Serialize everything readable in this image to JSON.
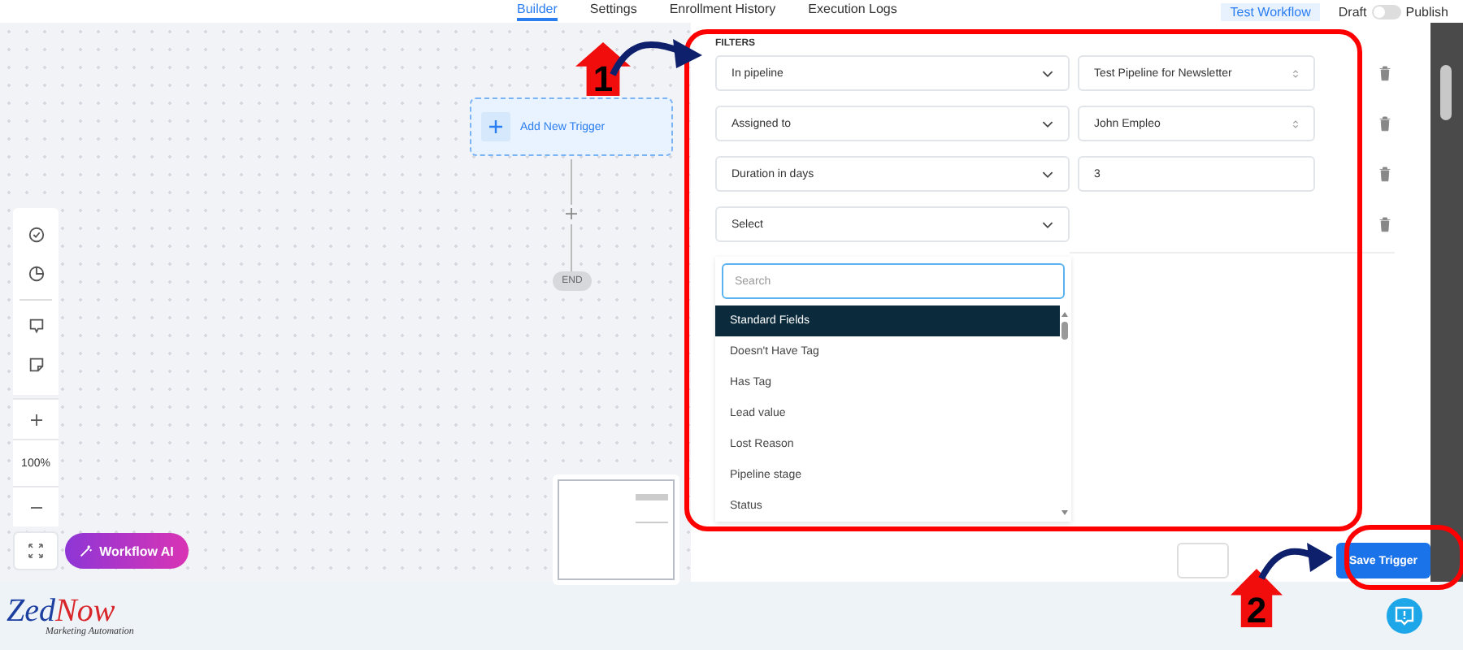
{
  "nav_tabs": [
    {
      "label": "Builder",
      "selected": true
    },
    {
      "label": "Settings",
      "selected": false
    },
    {
      "label": "Enrollment History",
      "selected": false
    },
    {
      "label": "Execution Logs",
      "selected": false
    }
  ],
  "test_button": "Test Workflow",
  "publish_toggle": {
    "off_label": "Draft",
    "on_label": "Publish",
    "on": false
  },
  "canvas": {
    "trigger_node": "Add New Trigger",
    "end_node": "END",
    "zoom_level": "100%",
    "ai_button": "Workflow AI"
  },
  "logo": {
    "first": "Zed",
    "second": "Now",
    "tagline": "Marketing Automation"
  },
  "filters": {
    "title": "FILTERS",
    "rows": [
      {
        "field": "In pipeline",
        "value": "Test Pipeline for Newsletter",
        "kind": "select"
      },
      {
        "field": "Assigned to",
        "value": "John Empleo",
        "kind": "select"
      },
      {
        "field": "Duration in days",
        "value": "3",
        "kind": "input"
      },
      {
        "field": "Select",
        "kind": "empty"
      }
    ],
    "dropdown": {
      "placeholder": "Search",
      "options": [
        {
          "label": "Standard Fields",
          "selected": true
        },
        {
          "label": "Doesn't Have Tag",
          "selected": false
        },
        {
          "label": "Has Tag",
          "selected": false
        },
        {
          "label": "Lead value",
          "selected": false
        },
        {
          "label": "Lost Reason",
          "selected": false
        },
        {
          "label": "Pipeline stage",
          "selected": false
        },
        {
          "label": "Status",
          "selected": false
        }
      ]
    }
  },
  "save_button": "Save Trigger",
  "annotations": [
    {
      "label": "1"
    },
    {
      "label": "2"
    }
  ]
}
